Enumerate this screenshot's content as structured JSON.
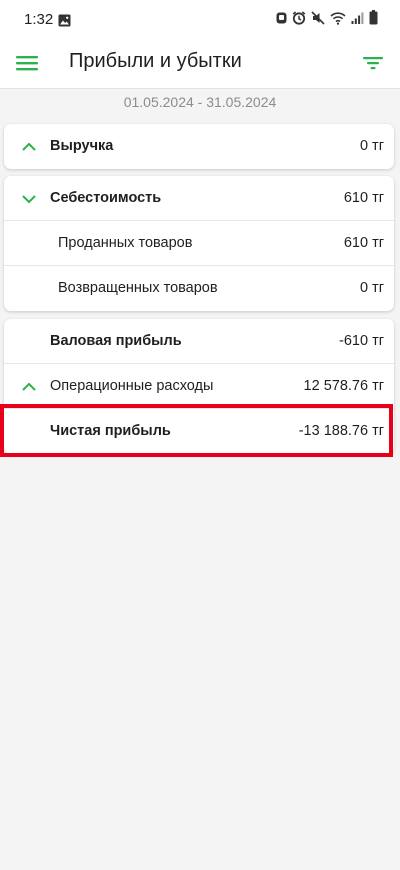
{
  "status_bar": {
    "time": "1:32",
    "icons": [
      "gallery-icon",
      "alarm-icon",
      "alarm-clock-icon",
      "mute-icon",
      "wifi-icon",
      "signal-icon",
      "battery-icon"
    ]
  },
  "app_bar": {
    "title": "Прибыли и убытки",
    "menu_icon": "hamburger-menu-icon",
    "filter_icon": "filter-icon"
  },
  "date_range": "01.05.2024 - 31.05.2024",
  "accent_color": "#2bb24c",
  "highlight_color": "#e8001a",
  "cards": {
    "revenue": {
      "label": "Выручка",
      "value": "0 тг",
      "chevron": "chevron-up-icon"
    },
    "cost": {
      "label": "Себестоимость",
      "value": "610 тг",
      "chevron": "chevron-down-icon",
      "items": [
        {
          "label": "Проданных товаров",
          "value": "610 тг"
        },
        {
          "label": "Возвращенных товаров",
          "value": "0 тг"
        }
      ]
    },
    "summary": {
      "gross_profit": {
        "label": "Валовая прибыль",
        "value": "-610 тг"
      },
      "operating_expenses": {
        "label": "Операционные расходы",
        "value": "12 578.76 тг",
        "chevron": "chevron-up-icon"
      },
      "net_profit": {
        "label": "Чистая прибыль",
        "value": "-13 188.76 тг"
      }
    }
  }
}
